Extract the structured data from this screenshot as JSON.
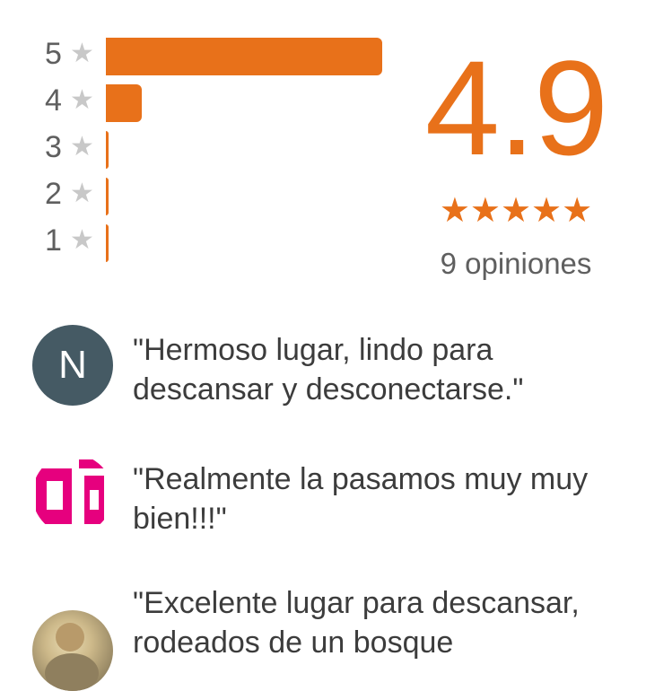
{
  "summary": {
    "score": "4.9",
    "score_stars": "★★★★★",
    "review_count": "9 opiniones",
    "accent_color": "#e8711a"
  },
  "histogram": {
    "star_glyph": "★",
    "rows": [
      {
        "label": "5",
        "fraction": 1.0
      },
      {
        "label": "4",
        "fraction": 0.13
      },
      {
        "label": "3",
        "fraction": 0.0
      },
      {
        "label": "2",
        "fraction": 0.0
      },
      {
        "label": "1",
        "fraction": 0.0
      }
    ]
  },
  "reviews": [
    {
      "avatar_letter": "N",
      "avatar_color": "#455a64",
      "text": "\"Hermoso lugar, lindo para descansar y desconectarse.\""
    },
    {
      "avatar_letter": "",
      "avatar_color": "#e6007e",
      "text": "\"Realmente la pasamos muy muy bien!!!\""
    },
    {
      "avatar_letter": "",
      "avatar_color": "#cdb98a",
      "text": "\"Excelente lugar para descansar, rodeados de un bosque"
    }
  ]
}
